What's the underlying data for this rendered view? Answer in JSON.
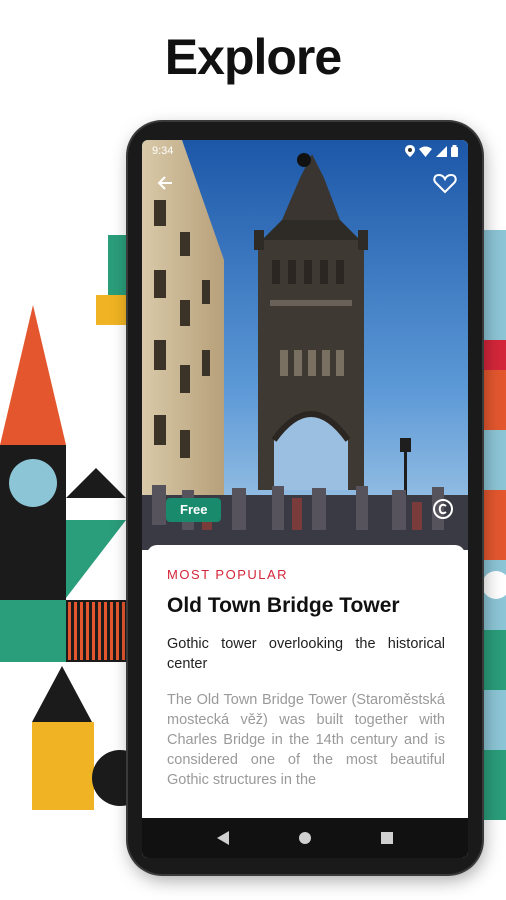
{
  "headline": "Explore",
  "status_bar": {
    "time": "9:34"
  },
  "hero": {
    "badge": "Free",
    "icons": {
      "back": "arrow-left-icon",
      "favorite": "heart-outline-icon",
      "copyright": "copyright-icon"
    }
  },
  "detail": {
    "category": "MOST POPULAR",
    "title": "Old Town Bridge Tower",
    "subtitle": "Gothic tower overlooking the historical center",
    "description": "The Old Town Bridge Tower (Staroměstská mostecká věž) was built together with Charles Bridge in the 14th century and is considered one of the most beautiful Gothic structures in the"
  },
  "nav": {
    "icons": [
      "back-triangle-icon",
      "home-circle-icon",
      "recents-square-icon"
    ]
  },
  "colors": {
    "accent_red": "#d4263a",
    "badge_green": "#1a8a6c",
    "deco_orange": "#e4572e",
    "deco_teal": "#2a9d7a",
    "deco_blue": "#8cc5d6",
    "deco_yellow": "#f0b323",
    "deco_black": "#1b1b1b"
  }
}
